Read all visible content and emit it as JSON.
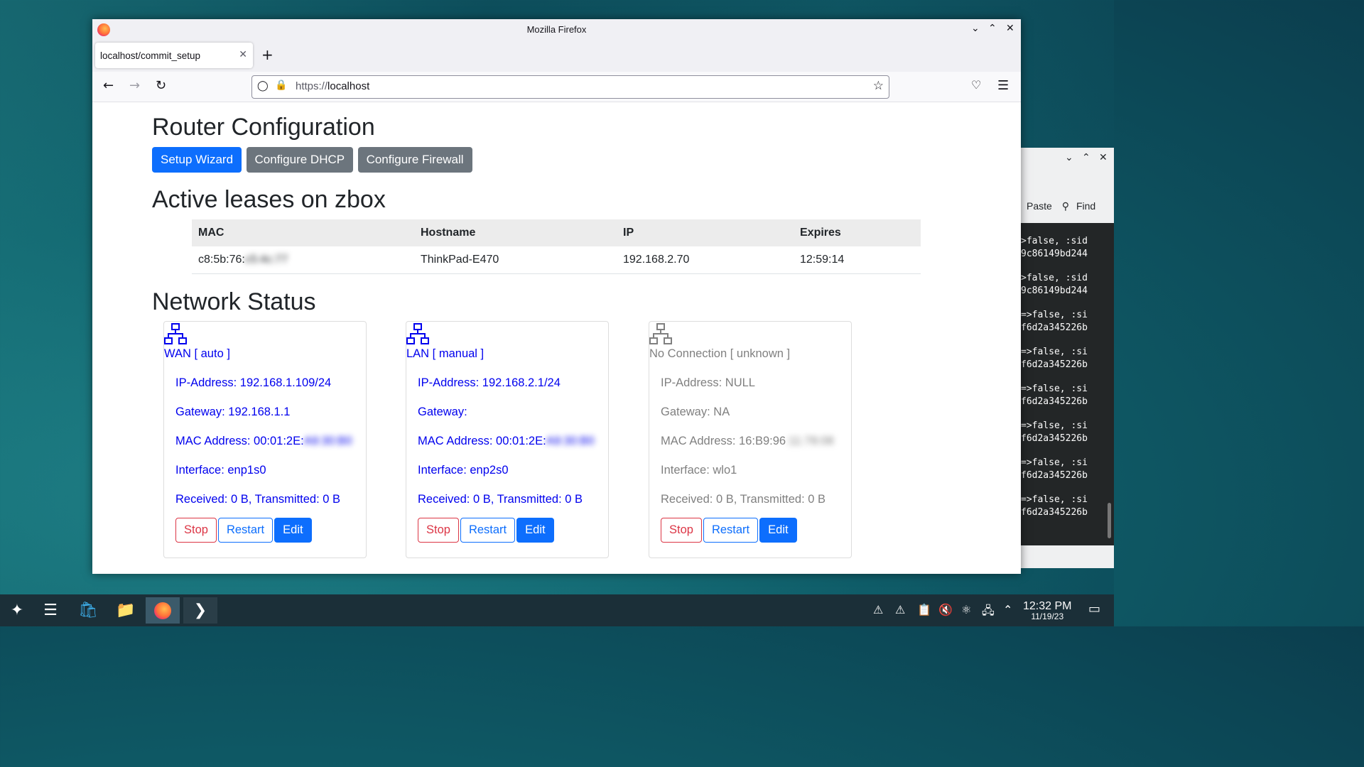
{
  "browser": {
    "window_title": "Mozilla Firefox",
    "tab_label": "localhost/commit_setup",
    "url_scheme": "https://",
    "url_host": "localhost"
  },
  "page": {
    "heading": "Router Configuration",
    "nav_buttons": [
      "Setup Wizard",
      "Configure DHCP",
      "Configure Firewall"
    ],
    "leases_heading": "Active leases on zbox",
    "leases_columns": [
      "MAC",
      "Hostname",
      "IP",
      "Expires"
    ],
    "leases_rows": [
      {
        "mac_visible": "c8:5b:76:",
        "mac_hidden": "c5:4c:77",
        "hostname": "ThinkPad-E470",
        "ip": "192.168.2.70",
        "expires": "12:59:14"
      }
    ],
    "network_heading": "Network Status",
    "cards": [
      {
        "title": "WAN [ auto ]",
        "ip": "IP-Address: 192.168.1.109/24",
        "gateway": "Gateway: 192.168.1.1",
        "mac_visible": "MAC Address: 00:01:2E:",
        "mac_hidden": "A9:30:B0",
        "iface": "Interface: enp1s0",
        "traffic": "Received: 0 B, Transmitted: 0 B",
        "stop": "Stop",
        "restart": "Restart",
        "edit": "Edit",
        "color": "#0000ee"
      },
      {
        "title": "LAN [ manual ]",
        "ip": "IP-Address: 192.168.2.1/24",
        "gateway": "Gateway:",
        "mac_visible": "MAC Address: 00:01:2E:",
        "mac_hidden": "A9:30:B0",
        "iface": "Interface: enp2s0",
        "traffic": "Received: 0 B, Transmitted: 0 B",
        "stop": "Stop",
        "restart": "Restart",
        "edit": "Edit",
        "color": "#0000ee"
      },
      {
        "title": "No Connection [ unknown ]",
        "ip": "IP-Address: NULL",
        "gateway": "Gateway: NA",
        "mac_visible": "MAC Address: 16:B9:96",
        "mac_hidden": ":11:78:08",
        "iface": "Interface: wlo1",
        "traffic": "Received: 0 B, Transmitted: 0 B",
        "stop": "Stop",
        "restart": "Restart",
        "edit": "Edit",
        "color": "#808080"
      }
    ]
  },
  "terminal": {
    "toolbar": [
      "Paste",
      "Find"
    ],
    "lines": [
      ">false, :sid",
      "9c86149bd244",
      ">false, :sid",
      "9c86149bd244",
      "=>false, :si",
      "f6d2a345226b",
      "=>false, :si",
      "f6d2a345226b",
      "=>false, :si",
      "f6d2a345226b",
      "=>false, :si",
      "f6d2a345226b",
      "=>false, :si",
      "f6d2a345226b",
      "=>false, :si",
      "f6d2a345226b"
    ]
  },
  "taskbar": {
    "time": "12:32 PM",
    "date": "11/19/23"
  },
  "colors": {
    "primary": "#0d6efd",
    "secondary": "#6c757d",
    "danger": "#dc3545"
  }
}
